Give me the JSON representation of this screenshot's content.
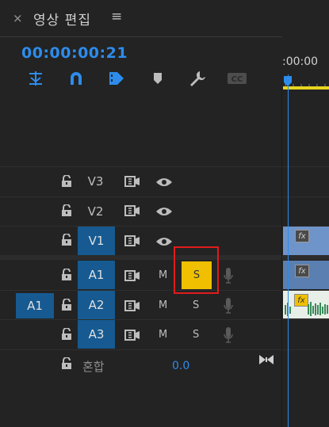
{
  "panel": {
    "close_glyph": "×",
    "title": "영상 편집",
    "menu_glyph": "≡"
  },
  "timecode": "00:00:00:21",
  "ruler": {
    "time_label": ":00:00"
  },
  "toolbar": {
    "icons": [
      "snap-nest-icon",
      "magnet-link-icon",
      "marker-insert-icon",
      "add-marker-icon",
      "wrench-settings-icon",
      "captions-cc-icon"
    ],
    "cc_label": "CC"
  },
  "tracks": {
    "video": [
      {
        "name": "V3",
        "selected": false
      },
      {
        "name": "V2",
        "selected": false
      },
      {
        "name": "V1",
        "selected": true
      }
    ],
    "audio": [
      {
        "name": "A1",
        "selected": true,
        "mute": "M",
        "solo": "S",
        "solo_active": true
      },
      {
        "name": "A2",
        "selected": true,
        "mute": "M",
        "solo": "S",
        "solo_active": false
      },
      {
        "name": "A3",
        "selected": true,
        "mute": "M",
        "solo": "S",
        "solo_active": false
      }
    ],
    "source_patch": "A1"
  },
  "mix": {
    "label": "혼합",
    "value": "0.0"
  },
  "clips": {
    "fx_label": "fx"
  },
  "colors": {
    "accent": "#2d8ceb",
    "selected_track": "#165a91",
    "solo_active": "#f0c000",
    "highlight": "#e01b1b",
    "ruler_bar": "#e8d41e"
  }
}
